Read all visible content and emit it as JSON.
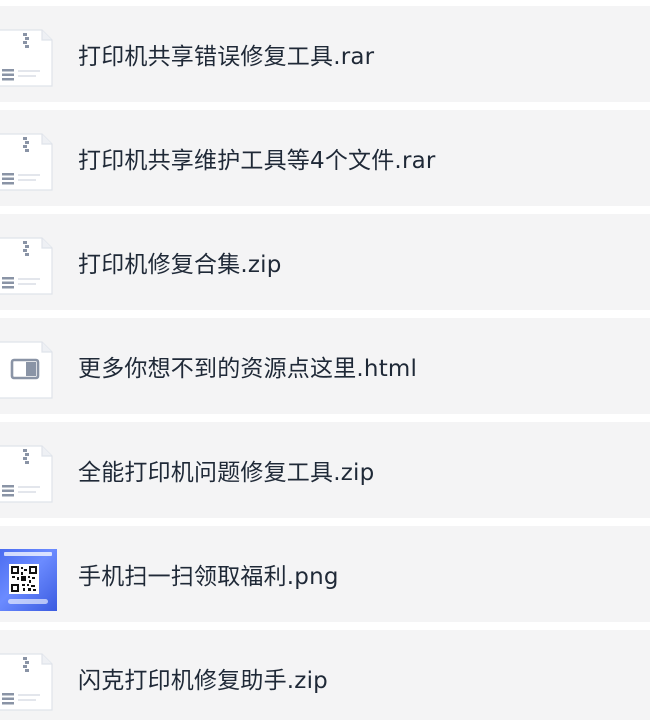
{
  "files": [
    {
      "name": "打印机共享错误修复工具.rar",
      "icon": "archive-file-icon"
    },
    {
      "name": "打印机共享维护工具等4个文件.rar",
      "icon": "archive-file-icon"
    },
    {
      "name": "打印机修复合集.zip",
      "icon": "archive-file-icon"
    },
    {
      "name": "更多你想不到的资源点这里.html",
      "icon": "html-file-icon"
    },
    {
      "name": "全能打印机问题修复工具.zip",
      "icon": "archive-file-icon"
    },
    {
      "name": "手机扫一扫领取福利.png",
      "icon": "image-thumbnail"
    },
    {
      "name": "闪克打印机修复助手.zip",
      "icon": "archive-file-icon"
    }
  ],
  "colors": {
    "row_background": "#f4f4f5",
    "text": "#1f2937",
    "icon_gray": "#8a94a6",
    "thumbnail_blue": "#4a6cf0"
  }
}
